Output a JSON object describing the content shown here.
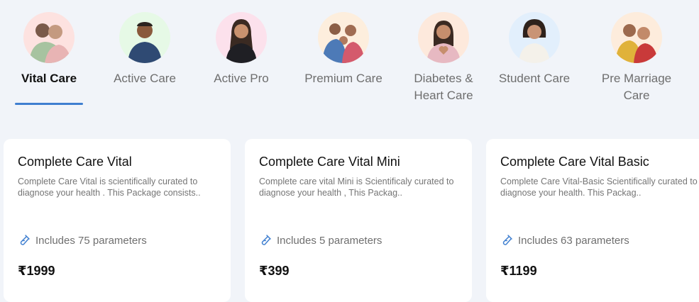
{
  "tabs": [
    {
      "label": "Vital Care",
      "icon": "avatar-couple-elderly",
      "bg": "#fde2e0",
      "active": true
    },
    {
      "label": "Active Care",
      "icon": "avatar-man",
      "bg": "#e6f9e6",
      "active": false
    },
    {
      "label": "Active Pro",
      "icon": "avatar-woman",
      "bg": "#fce1ec",
      "active": false
    },
    {
      "label": "Premium Care",
      "icon": "avatar-family",
      "bg": "#fdeedd",
      "active": false
    },
    {
      "label": "Diabetes & Heart Care",
      "icon": "avatar-woman-heart",
      "bg": "#fde9dc",
      "active": false
    },
    {
      "label": "Student Care",
      "icon": "avatar-student",
      "bg": "#e2effc",
      "active": false
    },
    {
      "label": "Pre Marriage Care",
      "icon": "avatar-couple",
      "bg": "#fdecdc",
      "active": false
    }
  ],
  "cards": [
    {
      "title": "Complete Care Vital",
      "desc": "Complete Care Vital is scientifically curated to diagnose your health . This Package consists..",
      "params": "Includes 75 parameters",
      "price": "₹1999"
    },
    {
      "title": "Complete Care Vital Mini",
      "desc": "Complete care vital Mini is Scientificaly curated to diagnose your health , This Packag..",
      "params": "Includes 5 parameters",
      "price": "₹399"
    },
    {
      "title": "Complete Care Vital Basic",
      "desc": "Complete Care Vital-Basic Scientifically curated to diagnose your health. This Packag..",
      "params": "Includes 63 parameters",
      "price": "₹1199"
    }
  ],
  "colors": {
    "accent": "#3f7fd0",
    "background": "#f1f4f9"
  }
}
